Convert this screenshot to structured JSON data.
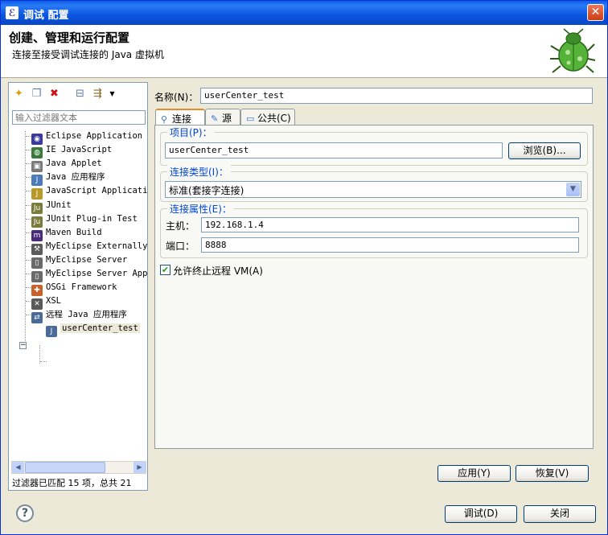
{
  "window": {
    "title": "调试 配置",
    "close_glyph": "✕"
  },
  "banner": {
    "heading": "创建、管理和运行配置",
    "description": "连接至接受调试连接的 Java 虚拟机"
  },
  "left": {
    "filter_placeholder": "输入过滤器文本",
    "tree": [
      {
        "label": "Eclipse Application",
        "icon": "eclipse-icon",
        "color": "#3b3b9e"
      },
      {
        "label": "IE JavaScript",
        "icon": "globe-icon",
        "color": "#3a7a3a"
      },
      {
        "label": "Java Applet",
        "icon": "applet-icon",
        "color": "#7a7a7a"
      },
      {
        "label": "Java 应用程序",
        "icon": "java-app-icon",
        "color": "#4a7ab8"
      },
      {
        "label": "JavaScript Applicatio",
        "icon": "javascript-icon",
        "color": "#b89a2a"
      },
      {
        "label": "JUnit",
        "icon": "junit-icon",
        "color": "#7a7a3a"
      },
      {
        "label": "JUnit Plug-in Test",
        "icon": "junit-plugin-icon",
        "color": "#7a7a3a"
      },
      {
        "label": "Maven Build",
        "icon": "maven-icon",
        "color": "#4a2a7a"
      },
      {
        "label": "MyEclipse Externally",
        "icon": "external-icon",
        "color": "#5a5a5a"
      },
      {
        "label": "MyEclipse Server",
        "icon": "server-icon",
        "color": "#6a6a6a"
      },
      {
        "label": "MyEclipse Server Appl",
        "icon": "server-app-icon",
        "color": "#6a6a6a"
      },
      {
        "label": "OSGi Framework",
        "icon": "osgi-icon",
        "color": "#c8622a"
      },
      {
        "label": "XSL",
        "icon": "xsl-icon",
        "color": "#5a5a5a"
      },
      {
        "label": "远程 Java 应用程序",
        "icon": "remote-java-icon",
        "color": "#4a6a9a"
      },
      {
        "label": "userCenter_test",
        "icon": "config-icon",
        "color": "#4a6a9a"
      }
    ],
    "filter_status": "过滤器已匹配 15 项，总共 21"
  },
  "right": {
    "name_label": "名称(N)：",
    "name_value": "userCenter_test",
    "tabs": [
      {
        "label": "连接",
        "icon": "connect-icon"
      },
      {
        "label": "源",
        "icon": "source-icon"
      },
      {
        "label": "公共(C)",
        "icon": "common-icon"
      }
    ],
    "project": {
      "title": "项目(P)：",
      "value": "userCenter_test",
      "browse": "浏览(B)..."
    },
    "conn_type": {
      "title": "连接类型(I)：",
      "value": "标准(套接字连接)"
    },
    "conn_props": {
      "title": "连接属性(E)：",
      "host_label": "主机：",
      "host_value": "192.168.1.4",
      "port_label": "端口：",
      "port_value": "8888"
    },
    "allow_terminate": "允许终止远程 VM(A)",
    "apply": "应用(Y)",
    "revert": "恢复(V)"
  },
  "footer": {
    "debug": "调试(D)",
    "close": "关闭"
  }
}
